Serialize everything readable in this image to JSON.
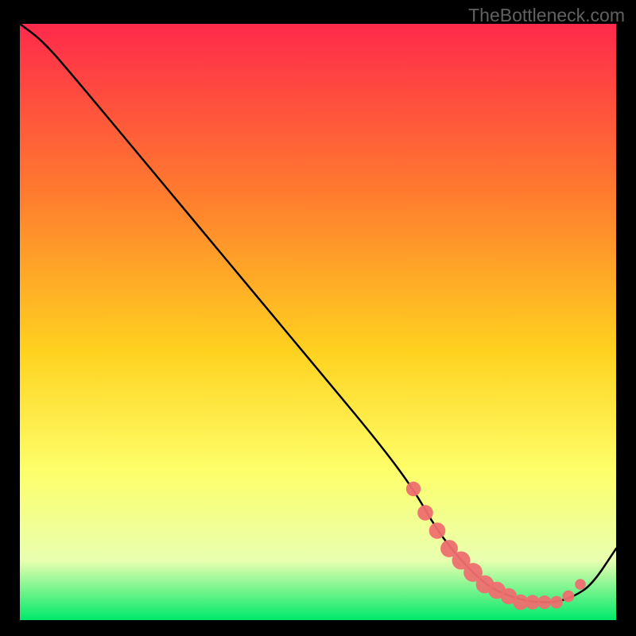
{
  "watermark": "TheBottleneck.com",
  "colors": {
    "background": "#000000",
    "gradient_top": "#ff2a4b",
    "gradient_mid1": "#ff7a2f",
    "gradient_mid2": "#ffd21f",
    "gradient_mid3": "#fdff6a",
    "gradient_mid4": "#e9ffb0",
    "gradient_bottom": "#00e96a",
    "line": "#000000",
    "marker_fill": "#ee6f6f",
    "marker_stroke": "#ee6f6f"
  },
  "chart_data": {
    "type": "line",
    "title": "",
    "xlabel": "",
    "ylabel": "",
    "xlim": [
      0,
      100
    ],
    "ylim": [
      0,
      100
    ],
    "series": [
      {
        "name": "curve",
        "x": [
          0,
          4,
          10,
          20,
          30,
          40,
          50,
          60,
          66,
          70,
          74,
          78,
          82,
          86,
          90,
          93,
          96,
          100
        ],
        "y": [
          100,
          97,
          90,
          78,
          66,
          54,
          42,
          30,
          22,
          15,
          10,
          6,
          4,
          3,
          3,
          4,
          6,
          12
        ]
      }
    ],
    "markers": {
      "name": "dots",
      "x": [
        66,
        68,
        70,
        72,
        74,
        76,
        78,
        80,
        82,
        84,
        86,
        88,
        90,
        92,
        94
      ],
      "y": [
        22,
        18,
        15,
        12,
        10,
        8,
        6,
        5,
        4,
        3,
        3,
        3,
        3,
        4,
        6
      ],
      "size_hint": "varied"
    }
  }
}
